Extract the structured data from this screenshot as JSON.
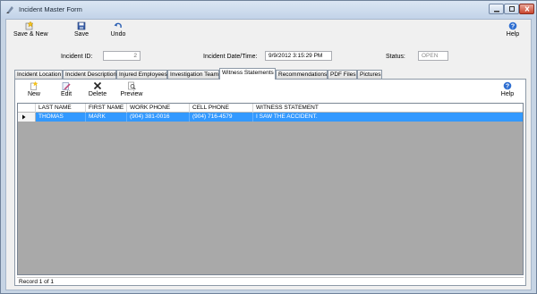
{
  "window": {
    "title": "Incident Master Form"
  },
  "toolbar": {
    "save_new_label": "Save & New",
    "save_label": "Save",
    "undo_label": "Undo",
    "help_label": "Help"
  },
  "header": {
    "incident_id_label": "Incident ID:",
    "incident_id_value": "2",
    "incident_datetime_label": "Incident Date/Time:",
    "incident_datetime_value": "9/9/2012 3:15:29 PM",
    "status_label": "Status:",
    "status_value": "OPEN"
  },
  "tabs": [
    {
      "label": "Incident Location"
    },
    {
      "label": "Incident Description"
    },
    {
      "label": "Injured Employees"
    },
    {
      "label": "Investigation Team"
    },
    {
      "label": "Witness Statements",
      "active": true
    },
    {
      "label": "Recommendations"
    },
    {
      "label": "PDF Files"
    },
    {
      "label": "Pictures"
    }
  ],
  "subtoolbar": {
    "new_label": "New",
    "edit_label": "Edit",
    "delete_label": "Delete",
    "preview_label": "Preview",
    "help_label": "Help"
  },
  "grid": {
    "columns": [
      "LAST NAME",
      "FIRST NAME",
      "WORK PHONE",
      "CELL PHONE",
      "WITNESS STATEMENT"
    ],
    "rows": [
      {
        "last_name": "THOMAS",
        "first_name": "MARK",
        "work_phone": "(904) 381-0016",
        "cell_phone": "(904) 716-4579",
        "statement": "I SAW THE ACCIDENT."
      }
    ]
  },
  "status_bar": {
    "record_text": "Record 1 of 1"
  },
  "colors": {
    "selection": "#3399ff",
    "grid_background": "#a9a9a9",
    "titlebar": "#c2d3e8"
  },
  "icons": [
    "app-icon",
    "minimize-icon",
    "maximize-icon",
    "close-icon",
    "save-new-icon",
    "save-icon",
    "undo-icon",
    "help-icon",
    "new-icon",
    "edit-icon",
    "delete-icon",
    "preview-icon",
    "row-pointer-icon"
  ]
}
